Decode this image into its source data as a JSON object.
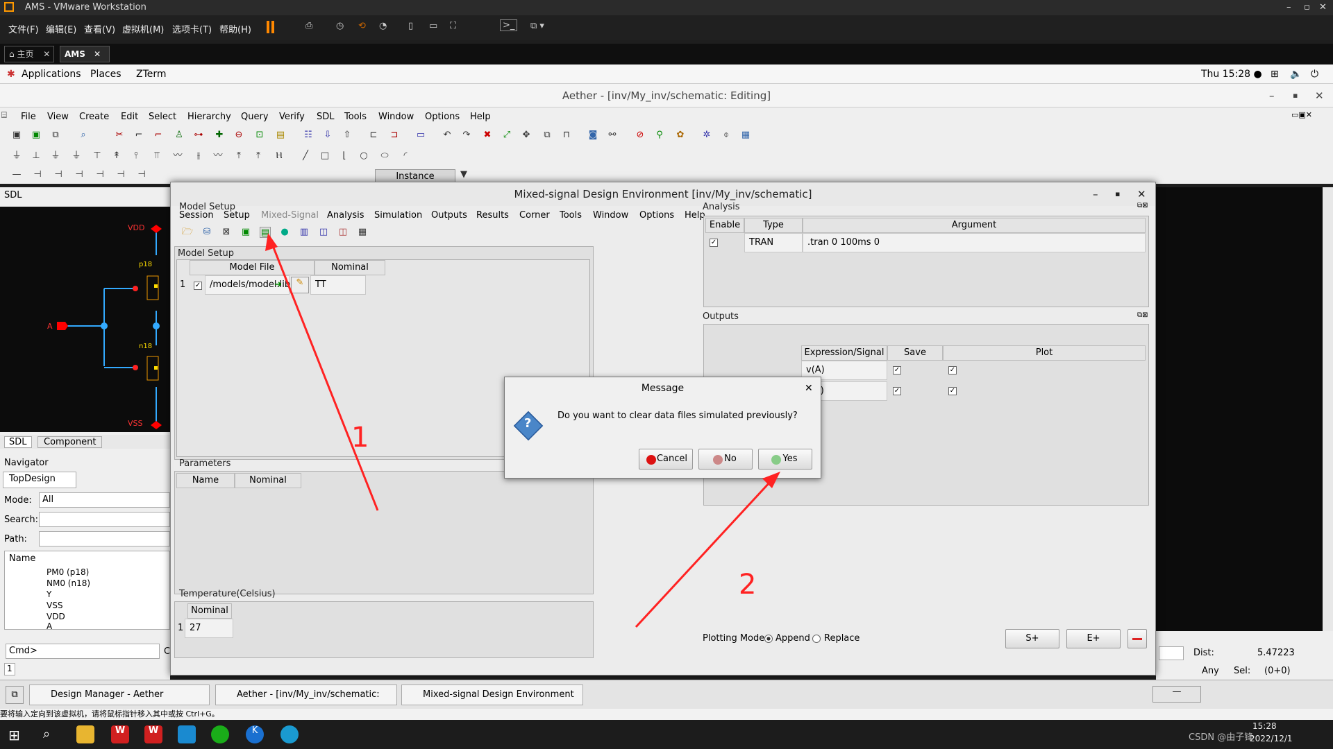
{
  "vmware": {
    "title": "AMS - VMware Workstation",
    "menus": [
      "文件(F)",
      "编辑(E)",
      "查看(V)",
      "虚拟机(M)",
      "选项卡(T)",
      "帮助(H)"
    ],
    "tabs": [
      "主页",
      "AMS"
    ]
  },
  "gnome": {
    "applications": "Applications",
    "places": "Places",
    "zterm": "ZTerm",
    "clock": "Thu 15:28 ●"
  },
  "aether": {
    "title": "Aether - [inv/My_inv/schematic: Editing]",
    "menus": [
      "File",
      "View",
      "Create",
      "Edit",
      "Select",
      "Hierarchy",
      "Query",
      "Verify",
      "SDL",
      "Tools",
      "Window",
      "Options",
      "Help"
    ],
    "instance": "Instance"
  },
  "left": {
    "sdl": "SDL",
    "tabs": [
      "SDL",
      "Component"
    ],
    "navigator": "Navigator",
    "topdesign": "TopDesign",
    "mode_label": "Mode:",
    "mode_value": "All",
    "search_label": "Search:",
    "path_label": "Path:",
    "name_header": "Name",
    "tree": [
      "PM0 (p18)",
      "NM0 (n18)",
      "Y",
      "VSS",
      "VDD",
      "A"
    ],
    "cmd": "Cmd>",
    "cmd2": "C",
    "num": "1"
  },
  "schematic": {
    "vdd": "VDD",
    "vss": "VSS",
    "a": "A",
    "p18": "p18",
    "n18": "n18"
  },
  "mde": {
    "title": "Mixed-signal Design Environment [inv/My_inv/schematic]",
    "menus": [
      "Session",
      "Setup",
      "Mixed-Signal",
      "Analysis",
      "Simulation",
      "Outputs",
      "Results",
      "Corner",
      "Tools",
      "Window",
      "Options",
      "Help"
    ],
    "model_setup": {
      "title": "Model Setup",
      "headers": [
        "Model File",
        "Nominal"
      ],
      "row_num": "1",
      "file": "/models/model.lib",
      "nominal": "TT"
    },
    "parameters": {
      "title": "Parameters",
      "headers": [
        "Name",
        "Nominal"
      ]
    },
    "temperature": {
      "title": "Temperature(Celsius)",
      "header": "Nominal",
      "row_num": "1",
      "value": "27"
    },
    "analysis": {
      "title": "Analysis",
      "headers": [
        "Enable",
        "Type",
        "Argument"
      ],
      "type": "TRAN",
      "argument": ".tran 0 100ms 0"
    },
    "outputs": {
      "title": "Outputs",
      "headers": [
        "Expression/Signal",
        "Save",
        "Plot"
      ],
      "rows": [
        "v(A)",
        "v(Y)"
      ]
    },
    "plotting": {
      "label": "Plotting Mode",
      "append": "Append",
      "replace": "Replace"
    },
    "buttons": {
      "s_plus": "S+",
      "e_plus": "E+"
    }
  },
  "message": {
    "title": "Message",
    "text": "Do you want to clear data files simulated previously?",
    "cancel": "Cancel",
    "no": "No",
    "yes": "Yes"
  },
  "annotations": {
    "one": "1",
    "two": "2"
  },
  "status": {
    "dist_label": "Dist:",
    "dist_value": "5.47223",
    "any": "Any",
    "sel": "Sel:",
    "sel_value": "(0+0)"
  },
  "taskbar": [
    "Design Manager - Aether",
    "Aether - [inv/My_inv/schematic: Editi...",
    "Mixed-signal Design Environment [in..."
  ],
  "vm_hint": "要将输入定向到该虚拟机，请将鼠标指针移入其中或按 Ctrl+G。",
  "windows": {
    "time": "15:28",
    "date": "2022/12/1",
    "watermark": "CSDN @由子锋"
  }
}
